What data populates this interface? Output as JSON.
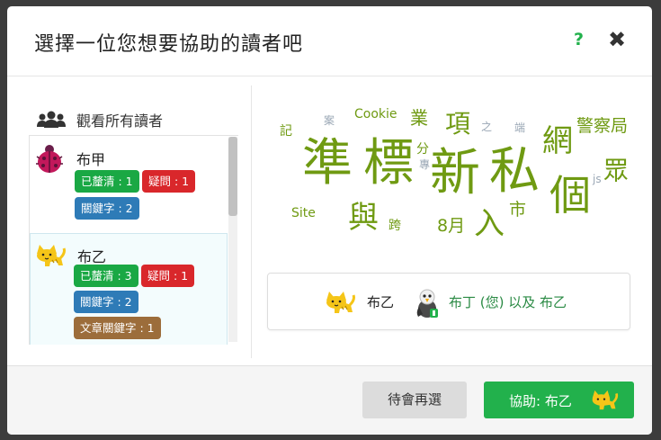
{
  "modal": {
    "title": "選擇一位您想要協助的讀者吧",
    "help_icon": "?",
    "close_icon": "✖"
  },
  "sidebar": {
    "all_readers_label": "觀看所有讀者",
    "readers": [
      {
        "name": "布甲",
        "avatar": "ladybug-icon",
        "badges": [
          {
            "label": "已釐清 : 1",
            "color": "#1aa844"
          },
          {
            "label": "疑問 : 1",
            "color": "#d9272b"
          },
          {
            "label": "關鍵字 : 2",
            "color": "#2e7bb7"
          }
        ]
      },
      {
        "name": "布乙",
        "avatar": "cat-icon",
        "selected": true,
        "badges": [
          {
            "label": "已釐清 : 3",
            "color": "#1aa844"
          },
          {
            "label": "疑問 : 1",
            "color": "#d9272b"
          },
          {
            "label": "關鍵字 : 2",
            "color": "#2e7bb7"
          },
          {
            "label": "文章關鍵字 : 1",
            "color": "#9c6d3b"
          }
        ]
      }
    ]
  },
  "word_cloud": {
    "words": [
      "記",
      "案",
      "Cookie",
      "業",
      "項",
      "之",
      "端",
      "警察局",
      "網",
      "準",
      "標",
      "分",
      "專",
      "新",
      "私",
      "js",
      "眾",
      "個",
      "Site",
      "與",
      "跨",
      "8月",
      "入",
      "市"
    ]
  },
  "selection": {
    "reader_name": "布乙",
    "helper_text": "布丁 (您)  以及  布乙"
  },
  "footer": {
    "later_label": "待會再選",
    "help_label": "協助: 布乙"
  },
  "colors": {
    "accent_green": "#22b14c",
    "word_green": "#6f9a12",
    "word_gray": "#9aa7b5"
  }
}
